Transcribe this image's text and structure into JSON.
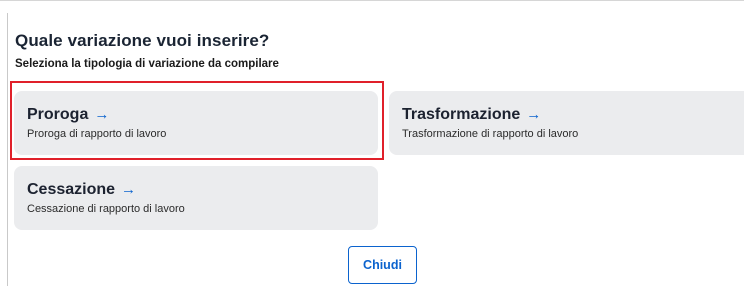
{
  "dialog": {
    "title": "Quale variazione vuoi inserire?",
    "subtitle": "Seleziona la tipologia di variazione da compilare",
    "arrow_glyph": "→",
    "options": [
      {
        "title": "Proroga",
        "description": "Proroga di rapporto di lavoro"
      },
      {
        "title": "Trasformazione",
        "description": "Trasformazione di rapporto di lavoro"
      },
      {
        "title": "Cessazione",
        "description": "Cessazione di rapporto di lavoro"
      }
    ],
    "close_label": "Chiudi"
  },
  "colors": {
    "accent": "#0b63ce",
    "card_background": "#ebecee",
    "highlight": "#e0202a"
  },
  "icons": {
    "option_arrow": "arrow-right-icon"
  }
}
